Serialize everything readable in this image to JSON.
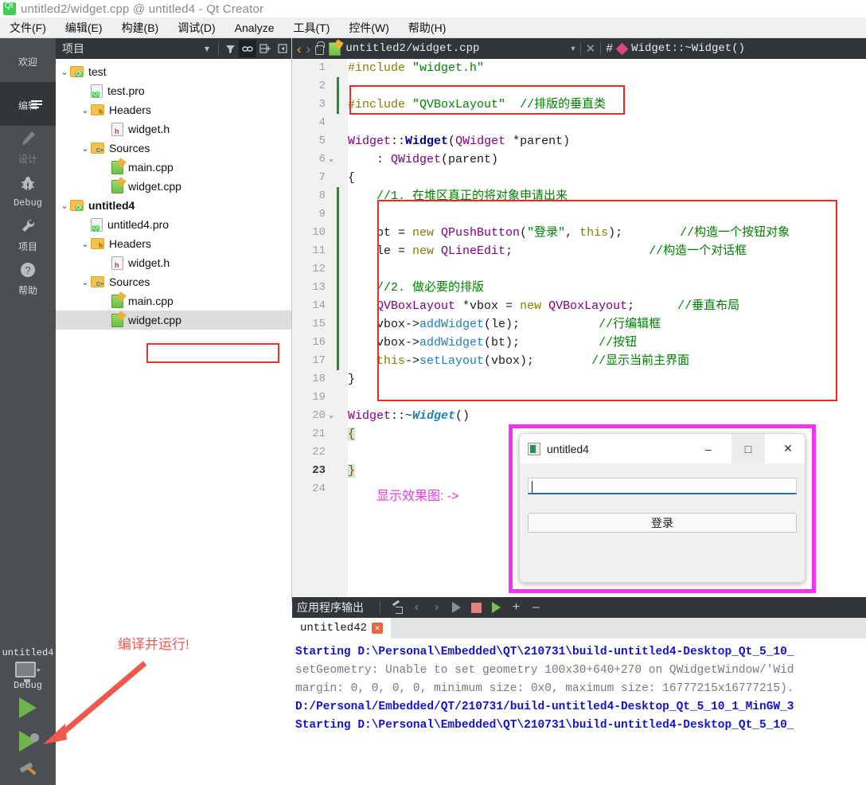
{
  "window": {
    "title": "untitled2/widget.cpp @ untitled4 - Qt Creator",
    "logo_icon": "qt-logo-icon"
  },
  "menubar": {
    "items": [
      {
        "label": "文件(F)"
      },
      {
        "label": "编辑(E)"
      },
      {
        "label": "构建(B)"
      },
      {
        "label": "调试(D)"
      },
      {
        "label": "Analyze"
      },
      {
        "label": "工具(T)"
      },
      {
        "label": "控件(W)"
      },
      {
        "label": "帮助(H)"
      }
    ]
  },
  "modebar": {
    "items": [
      {
        "label": "欢迎",
        "icon": "grid-icon",
        "state": "normal"
      },
      {
        "label": "编辑",
        "icon": "document-icon",
        "state": "active"
      },
      {
        "label": "设计",
        "icon": "pencil-icon",
        "state": "disabled"
      },
      {
        "label": "Debug",
        "icon": "bug-icon",
        "state": "normal"
      },
      {
        "label": "项目",
        "icon": "wrench-icon",
        "state": "normal"
      },
      {
        "label": "帮助",
        "icon": "question-icon",
        "state": "normal"
      }
    ]
  },
  "kit_selector": {
    "project": "untitled4",
    "build_config": "Debug",
    "run_button": "run-icon",
    "debug_button": "debug-run-icon",
    "build_button": "hammer-icon"
  },
  "project_panel": {
    "header_title": "项目",
    "toolbar": [
      {
        "name": "chevron-down-icon",
        "label": "▾"
      },
      {
        "name": "filter-icon",
        "label": "▼"
      },
      {
        "name": "link-icon",
        "label": "⚭"
      },
      {
        "name": "split-add-icon",
        "label": "⊞+"
      },
      {
        "name": "collapse-panel-icon",
        "label": "◂"
      }
    ],
    "tree": [
      {
        "depth": 0,
        "chev": "⌄",
        "icon": "folder-qt-icon",
        "label": "test",
        "bold": false,
        "selected": false
      },
      {
        "depth": 1,
        "chev": "",
        "icon": "file-pro-icon",
        "label": "test.pro",
        "bold": false,
        "selected": false
      },
      {
        "depth": 1,
        "chev": "⌄",
        "icon": "folder-h-icon",
        "label": "Headers",
        "bold": false,
        "selected": false
      },
      {
        "depth": 2,
        "chev": "",
        "icon": "file-h-icon",
        "label": "widget.h",
        "bold": false,
        "selected": false
      },
      {
        "depth": 1,
        "chev": "⌄",
        "icon": "folder-cpp-icon",
        "label": "Sources",
        "bold": false,
        "selected": false
      },
      {
        "depth": 2,
        "chev": "",
        "icon": "file-cpp-icon",
        "label": "main.cpp",
        "bold": false,
        "selected": false
      },
      {
        "depth": 2,
        "chev": "",
        "icon": "file-cpp-icon",
        "label": "widget.cpp",
        "bold": false,
        "selected": false
      },
      {
        "depth": 0,
        "chev": "⌄",
        "icon": "folder-qt-icon",
        "label": "untitled4",
        "bold": true,
        "selected": false
      },
      {
        "depth": 1,
        "chev": "",
        "icon": "file-pro-icon",
        "label": "untitled4.pro",
        "bold": false,
        "selected": false
      },
      {
        "depth": 1,
        "chev": "⌄",
        "icon": "folder-h-icon",
        "label": "Headers",
        "bold": false,
        "selected": false
      },
      {
        "depth": 2,
        "chev": "",
        "icon": "file-h-icon",
        "label": "widget.h",
        "bold": false,
        "selected": false
      },
      {
        "depth": 1,
        "chev": "⌄",
        "icon": "folder-cpp-icon",
        "label": "Sources",
        "bold": false,
        "selected": false
      },
      {
        "depth": 2,
        "chev": "",
        "icon": "file-cpp-icon",
        "label": "main.cpp",
        "bold": false,
        "selected": false
      },
      {
        "depth": 2,
        "chev": "",
        "icon": "file-cpp-icon",
        "label": "widget.cpp",
        "bold": false,
        "selected": true
      }
    ]
  },
  "editor": {
    "toolbar": {
      "back_icon": "‹",
      "forward_icon": "›",
      "lock_icon": "unlock-icon",
      "file_icon": "file-cpp-icon",
      "filename": "untitled2/widget.cpp",
      "dropdown_icon": "▾",
      "close_icon": "✕",
      "hash_icon": "#",
      "symbol_marker": "diamond-icon",
      "symbol": "Widget::~Widget()"
    },
    "lines": [
      {
        "n": "1",
        "fold": "",
        "bar": "",
        "segs": [
          {
            "t": "#include ",
            "c": "k-pre"
          },
          {
            "t": "\"widget.h\"",
            "c": "k-str"
          }
        ]
      },
      {
        "n": "2",
        "fold": "",
        "bar": "green",
        "segs": []
      },
      {
        "n": "3",
        "fold": "",
        "bar": "green",
        "segs": [
          {
            "t": "#include ",
            "c": "k-pre"
          },
          {
            "t": "\"QVBoxLayout\"",
            "c": "k-str"
          },
          {
            "t": "  ",
            "c": "k-op"
          },
          {
            "t": "//排版的垂直类",
            "c": "k-cmt"
          }
        ]
      },
      {
        "n": "4",
        "fold": "",
        "bar": "",
        "segs": []
      },
      {
        "n": "5",
        "fold": "",
        "bar": "",
        "segs": [
          {
            "t": "Widget",
            "c": "k-typ"
          },
          {
            "t": "::",
            "c": "k-op"
          },
          {
            "t": "Widget",
            "c": "k-decl"
          },
          {
            "t": "(",
            "c": "k-op"
          },
          {
            "t": "QWidget ",
            "c": "k-typ"
          },
          {
            "t": "*parent)",
            "c": "k-op"
          }
        ]
      },
      {
        "n": "6",
        "fold": "⌄",
        "bar": "",
        "segs": [
          {
            "t": "    : ",
            "c": "k-op"
          },
          {
            "t": "QWidget",
            "c": "k-typ"
          },
          {
            "t": "(parent)",
            "c": "k-op"
          }
        ]
      },
      {
        "n": "7",
        "fold": "",
        "bar": "",
        "segs": [
          {
            "t": "{",
            "c": "k-op"
          }
        ]
      },
      {
        "n": "8",
        "fold": "",
        "bar": "green",
        "segs": [
          {
            "t": "    //1. 在堆区真正的将对象申请出来",
            "c": "k-cmt"
          }
        ]
      },
      {
        "n": "9",
        "fold": "",
        "bar": "green",
        "segs": []
      },
      {
        "n": "10",
        "fold": "",
        "bar": "green",
        "segs": [
          {
            "t": "    bt ",
            "c": "k-var"
          },
          {
            "t": "= ",
            "c": "k-op"
          },
          {
            "t": "new ",
            "c": "k-kw"
          },
          {
            "t": "QPushButton",
            "c": "k-typ"
          },
          {
            "t": "(",
            "c": "k-op"
          },
          {
            "t": "\"登录\"",
            "c": "k-str"
          },
          {
            "t": ", ",
            "c": "k-op"
          },
          {
            "t": "this",
            "c": "k-kw"
          },
          {
            "t": ");        ",
            "c": "k-op"
          },
          {
            "t": "//构造一个按钮对象",
            "c": "k-cmt"
          }
        ]
      },
      {
        "n": "11",
        "fold": "",
        "bar": "green",
        "segs": [
          {
            "t": "    le ",
            "c": "k-var"
          },
          {
            "t": "= ",
            "c": "k-op"
          },
          {
            "t": "new ",
            "c": "k-kw"
          },
          {
            "t": "QLineEdit",
            "c": "k-typ"
          },
          {
            "t": ";                   ",
            "c": "k-op"
          },
          {
            "t": "//构造一个对话框",
            "c": "k-cmt"
          }
        ]
      },
      {
        "n": "12",
        "fold": "",
        "bar": "green",
        "segs": []
      },
      {
        "n": "13",
        "fold": "",
        "bar": "green",
        "segs": [
          {
            "t": "    //2. 做必要的排版",
            "c": "k-cmt"
          }
        ]
      },
      {
        "n": "14",
        "fold": "",
        "bar": "green",
        "segs": [
          {
            "t": "    QVBoxLayout ",
            "c": "k-typ"
          },
          {
            "t": "*vbox ",
            "c": "k-var"
          },
          {
            "t": "= ",
            "c": "k-op"
          },
          {
            "t": "new ",
            "c": "k-kw"
          },
          {
            "t": "QVBoxLayout",
            "c": "k-typ"
          },
          {
            "t": ";      ",
            "c": "k-op"
          },
          {
            "t": "//垂直布局",
            "c": "k-cmt"
          }
        ]
      },
      {
        "n": "15",
        "fold": "",
        "bar": "green",
        "segs": [
          {
            "t": "    vbox",
            "c": "k-var"
          },
          {
            "t": "->",
            "c": "k-op"
          },
          {
            "t": "addWidget",
            "c": "k-fn"
          },
          {
            "t": "(le);           ",
            "c": "k-op"
          },
          {
            "t": "//行编辑框",
            "c": "k-cmt"
          }
        ]
      },
      {
        "n": "16",
        "fold": "",
        "bar": "green",
        "segs": [
          {
            "t": "    vbox",
            "c": "k-var"
          },
          {
            "t": "->",
            "c": "k-op"
          },
          {
            "t": "addWidget",
            "c": "k-fn"
          },
          {
            "t": "(bt);           ",
            "c": "k-op"
          },
          {
            "t": "//按钮",
            "c": "k-cmt"
          }
        ]
      },
      {
        "n": "17",
        "fold": "",
        "bar": "green",
        "segs": [
          {
            "t": "    this",
            "c": "k-kw"
          },
          {
            "t": "->",
            "c": "k-op"
          },
          {
            "t": "setLayout",
            "c": "k-fn"
          },
          {
            "t": "(vbox);        ",
            "c": "k-op"
          },
          {
            "t": "//显示当前主界面",
            "c": "k-cmt"
          }
        ]
      },
      {
        "n": "18",
        "fold": "",
        "bar": "",
        "segs": [
          {
            "t": "}",
            "c": "k-op"
          }
        ]
      },
      {
        "n": "19",
        "fold": "",
        "bar": "",
        "segs": []
      },
      {
        "n": "20",
        "fold": "⌄",
        "bar": "",
        "segs": [
          {
            "t": "Widget",
            "c": "k-typ"
          },
          {
            "t": "::~",
            "c": "k-op"
          },
          {
            "t": "Widget",
            "c": "k-dtor"
          },
          {
            "t": "()",
            "c": "k-op"
          }
        ]
      },
      {
        "n": "21",
        "fold": "",
        "bar": "",
        "segs": [
          {
            "t": "{",
            "c": "brace-hl"
          }
        ]
      },
      {
        "n": "22",
        "fold": "",
        "bar": "",
        "segs": []
      },
      {
        "n": "23",
        "fold": "",
        "bar": "",
        "current": true,
        "segs": [
          {
            "t": "}",
            "c": "brace-hl"
          }
        ]
      },
      {
        "n": "24",
        "fold": "",
        "bar": "",
        "segs": []
      }
    ],
    "annotation_preview": "显示效果图: ->"
  },
  "app_window": {
    "title": "untitled4",
    "icon": "app-icon",
    "minimize": "–",
    "maximize": "□",
    "close": "✕",
    "lineedit_value": "",
    "button_label": "登录"
  },
  "output_pane": {
    "title": "应用程序输出",
    "toolbar": [
      {
        "name": "clear-icon",
        "label": ""
      },
      {
        "name": "prev-item-icon",
        "label": "‹"
      },
      {
        "name": "next-item-icon",
        "label": "›"
      },
      {
        "name": "rerun-icon",
        "label": ""
      },
      {
        "name": "stop-icon",
        "label": ""
      },
      {
        "name": "attach-debugger-icon",
        "label": ""
      },
      {
        "name": "zoom-in-icon",
        "label": "+"
      },
      {
        "name": "zoom-out-icon",
        "label": "–"
      }
    ],
    "tab": {
      "label": "untitled42",
      "close_icon": "✕"
    },
    "lines": [
      {
        "text": "Starting D:\\Personal\\Embedded\\QT\\210731\\build-untitled4-Desktop_Qt_5_10_",
        "style": "blue"
      },
      {
        "text": "setGeometry: Unable to set geometry 100x30+640+270 on QWidgetWindow/'Wid",
        "style": "gray"
      },
      {
        "text": "margin: 0, 0, 0, 0, minimum size: 0x0, maximum size: 16777215x16777215).",
        "style": "gray"
      },
      {
        "text": "D:/Personal/Embedded/QT/210731/build-untitled4-Desktop_Qt_5_10_1_MinGW_3",
        "style": "blue"
      },
      {
        "text": "",
        "style": "gray"
      },
      {
        "text": "Starting D:\\Personal\\Embedded\\QT\\210731\\build-untitled4-Desktop_Qt_5_10_",
        "style": "blue"
      }
    ]
  },
  "annotations": {
    "run_note": "编译并运行!",
    "preview_note": "显示效果图: ->",
    "colors": {
      "red_box": "#ef2a22",
      "magenta_box": "#ef34ef",
      "red_text": "#f0584f",
      "magenta_text": "#e23ce2"
    }
  }
}
